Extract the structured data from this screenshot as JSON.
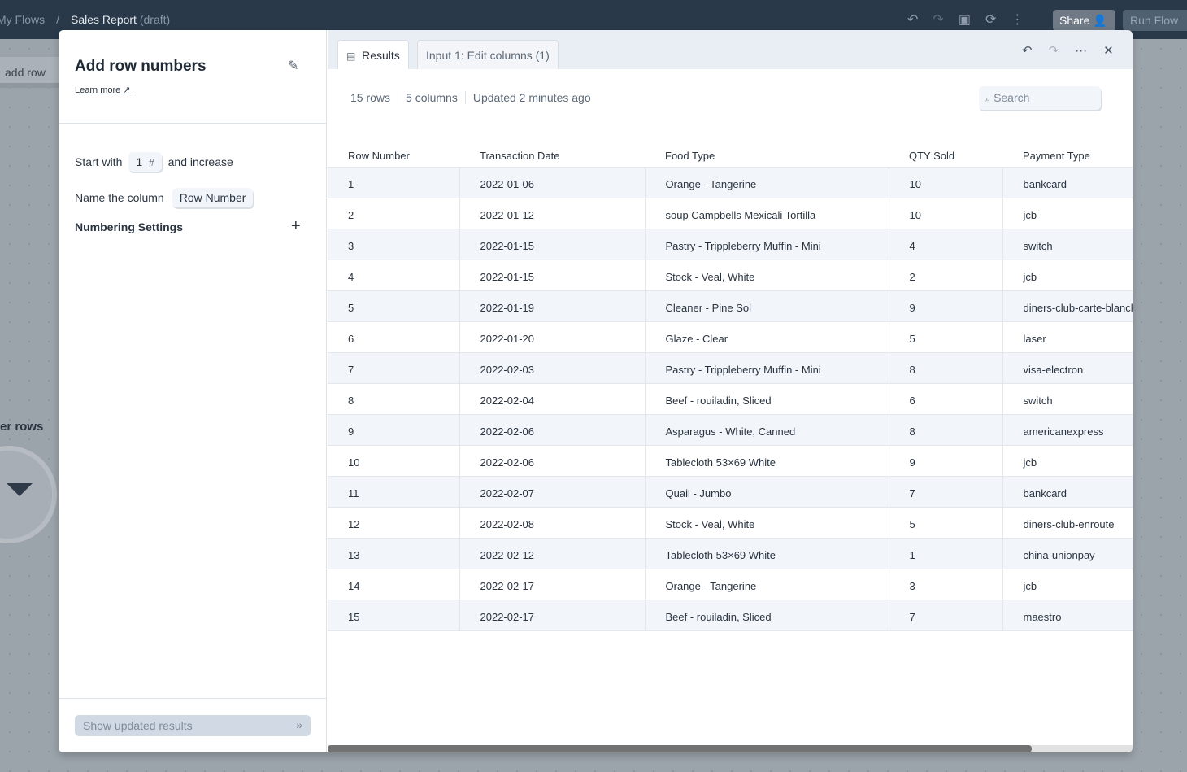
{
  "topbar": {
    "crumb_root": "My Flows",
    "separator": "/",
    "title": "Sales Report",
    "status": "(draft)",
    "share": "Share",
    "run": "Run Flow"
  },
  "background": {
    "add_row": "add row",
    "filter_label": "er rows"
  },
  "panel": {
    "title": "Add row numbers",
    "learn_more": "Learn more",
    "start_with_label": "Start with",
    "start_value": "1",
    "start_unit": "#",
    "and_increase": "and increase",
    "name_label": "Name the column",
    "column_name": "Row Number",
    "numbering_settings": "Numbering Settings",
    "show_updated": "Show updated results"
  },
  "results": {
    "tabs": [
      "Results",
      "Input 1: Edit columns (1)"
    ],
    "rows_count": "15 rows",
    "columns_count": "5 columns",
    "updated": "Updated 2 minutes ago",
    "search_placeholder": "Search"
  },
  "table": {
    "headers": [
      "Row Number",
      "Transaction Date",
      "Food Type",
      "QTY Sold",
      "Payment Type"
    ],
    "rows": [
      [
        "1",
        "2022-01-06",
        "Orange - Tangerine",
        "10",
        "bankcard"
      ],
      [
        "2",
        "2022-01-12",
        "soup Campbells Mexicali Tortilla",
        "10",
        "jcb"
      ],
      [
        "3",
        "2022-01-15",
        "Pastry - Trippleberry Muffin - Mini",
        "4",
        "switch"
      ],
      [
        "4",
        "2022-01-15",
        "Stock - Veal, White",
        "2",
        "jcb"
      ],
      [
        "5",
        "2022-01-19",
        "Cleaner - Pine Sol",
        "9",
        "diners-club-carte-blanche"
      ],
      [
        "6",
        "2022-01-20",
        "Glaze - Clear",
        "5",
        "laser"
      ],
      [
        "7",
        "2022-02-03",
        "Pastry - Trippleberry Muffin - Mini",
        "8",
        "visa-electron"
      ],
      [
        "8",
        "2022-02-04",
        "Beef - rouiladin, Sliced",
        "6",
        "switch"
      ],
      [
        "9",
        "2022-02-06",
        "Asparagus - White, Canned",
        "8",
        "americanexpress"
      ],
      [
        "10",
        "2022-02-06",
        "Tablecloth 53×69 White",
        "9",
        "jcb"
      ],
      [
        "11",
        "2022-02-07",
        "Quail - Jumbo",
        "7",
        "bankcard"
      ],
      [
        "12",
        "2022-02-08",
        "Stock - Veal, White",
        "5",
        "diners-club-enroute"
      ],
      [
        "13",
        "2022-02-12",
        "Tablecloth 53×69 White",
        "1",
        "china-unionpay"
      ],
      [
        "14",
        "2022-02-17",
        "Orange - Tangerine",
        "3",
        "jcb"
      ],
      [
        "15",
        "2022-02-17",
        "Beef - rouiladin, Sliced",
        "7",
        "maestro"
      ]
    ]
  }
}
